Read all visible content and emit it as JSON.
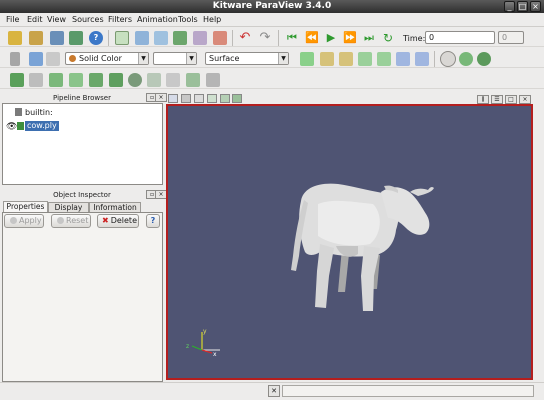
{
  "window": {
    "title": "Kitware ParaView 3.4.0"
  },
  "menu": [
    "File",
    "Edit",
    "View",
    "Sources",
    "Filters",
    "Animation",
    "Tools",
    "Help"
  ],
  "toolbar": {
    "time_label": "Time:",
    "time_value": "0",
    "time_index": "0",
    "color_by": "Solid Color",
    "color_component": "",
    "representation": "Surface"
  },
  "pipeline": {
    "title": "Pipeline Browser",
    "items": [
      {
        "label": "builtin:"
      },
      {
        "label": "cow.ply"
      }
    ]
  },
  "inspector": {
    "title": "Object Inspector",
    "tabs": [
      "Properties",
      "Display",
      "Information"
    ],
    "apply_label": "Apply",
    "reset_label": "Reset",
    "delete_label": "Delete",
    "help_label": "?"
  },
  "axes": {
    "x": "x",
    "y": "y",
    "z": "z"
  },
  "colors": {
    "viewport_bg": "#4f5473",
    "active_border": "#b41e1e",
    "selection": "#3d6fb0",
    "cow": "#e6e6e6"
  }
}
